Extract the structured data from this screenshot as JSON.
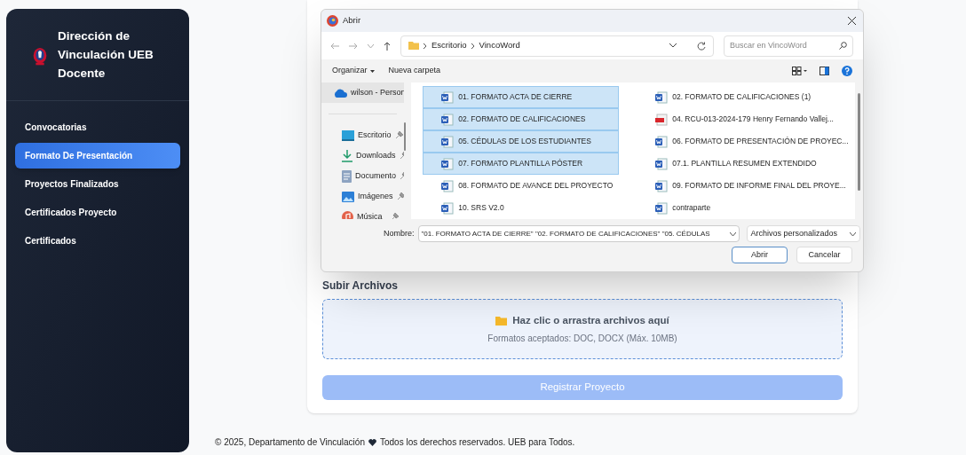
{
  "sidebar": {
    "title": "Dirección de Vinculación UEB",
    "subtitle": "Docente",
    "items": [
      {
        "label": "Convocatorias",
        "selected": false
      },
      {
        "label": "Formato De Presentación",
        "selected": true
      },
      {
        "label": "Proyectos Finalizados",
        "selected": false
      },
      {
        "label": "Certificados Proyecto",
        "selected": false
      },
      {
        "label": "Certificados",
        "selected": false
      }
    ]
  },
  "upload": {
    "heading": "Subir Archivos",
    "drop_title": "Haz clic o arrastra archivos aquí",
    "drop_hint": "Formatos aceptados: DOC, DOCX (Máx. 10MB)",
    "submit": {
      "label": "Registrar Proyecto",
      "disabled": true
    }
  },
  "footer": {
    "left": "© 2025, Departamento de Vinculación",
    "right": "Todos los derechos reservados. UEB para Todos."
  },
  "dialog": {
    "title": "Abrir",
    "path": [
      "Escritorio",
      "VincoWord"
    ],
    "search_placeholder": "Buscar en VincoWord",
    "toolbar": [
      "Organizar",
      "Nueva carpeta"
    ],
    "nav": [
      {
        "label": "wilson - Person",
        "kind": "cloud",
        "selected": true
      },
      {
        "label": "Escritorio",
        "kind": "desktop",
        "selected": false
      },
      {
        "label": "Downloads",
        "kind": "download",
        "selected": false
      },
      {
        "label": "Documento",
        "kind": "document",
        "selected": false
      },
      {
        "label": "Imágenes",
        "kind": "pictures",
        "selected": false
      },
      {
        "label": "Música",
        "kind": "music",
        "selected": false
      }
    ],
    "files": [
      {
        "name": "01. FORMATO ACTA DE CIERRE",
        "kind": "word",
        "selected": true
      },
      {
        "name": "02. FORMATO DE CALIFICACIONES (1)",
        "kind": "word",
        "selected": false
      },
      {
        "name": "02. FORMATO DE CALIFICACIONES",
        "kind": "word",
        "selected": true
      },
      {
        "name": "04. RCU-013-2024-179 Henry Fernando Vallej...",
        "kind": "pdf",
        "selected": false
      },
      {
        "name": "05. CÉDULAS DE LOS ESTUDIANTES",
        "kind": "word",
        "selected": true
      },
      {
        "name": "06. FORMATO DE PRESENTACIÓN DE PROYEC...",
        "kind": "word",
        "selected": false
      },
      {
        "name": "07. FORMATO PLANTILLA PÓSTER",
        "kind": "word",
        "selected": true
      },
      {
        "name": "07.1. PLANTILLA RESUMEN EXTENDIDO",
        "kind": "word",
        "selected": false
      },
      {
        "name": "08. FORMATO DE AVANCE DEL PROYECTO",
        "kind": "word",
        "selected": false
      },
      {
        "name": "09. FORMATO DE INFORME FINAL DEL PROYE...",
        "kind": "word",
        "selected": false
      },
      {
        "name": "10. SRS V2.0",
        "kind": "word",
        "selected": false
      },
      {
        "name": "contraparte",
        "kind": "word",
        "selected": false
      }
    ],
    "filename_label": "Nombre:",
    "filename_value": "\"01. FORMATO ACTA DE CIERRE\" \"02. FORMATO DE CALIFICACIONES\" \"05. CÉDULAS",
    "filetype": "Archivos personalizados",
    "buttons": [
      "Abrir",
      "Cancelar"
    ]
  }
}
